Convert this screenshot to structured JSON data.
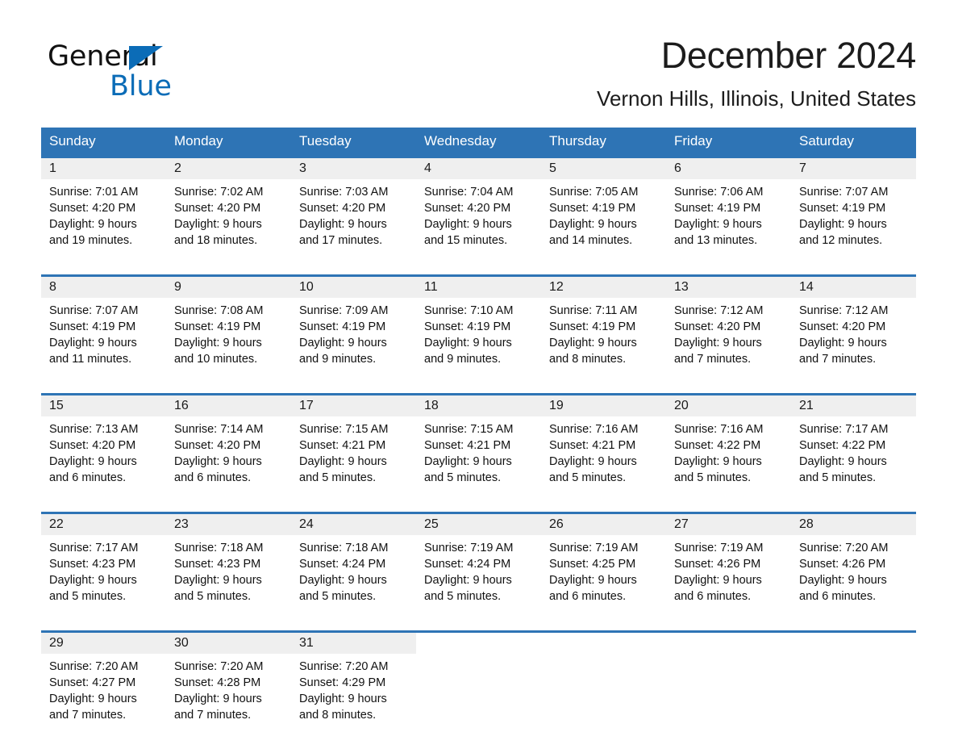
{
  "brand": {
    "name_part1": "General",
    "name_part2": "Blue",
    "triangle_icon": "triangle-icon",
    "accent_color": "#0b6cb7"
  },
  "header": {
    "month_title": "December 2024",
    "location": "Vernon Hills, Illinois, United States"
  },
  "calendar": {
    "header_color": "#2e74b5",
    "daynum_band_color": "#efefef",
    "weekday_headers": [
      "Sunday",
      "Monday",
      "Tuesday",
      "Wednesday",
      "Thursday",
      "Friday",
      "Saturday"
    ],
    "weeks": [
      [
        {
          "day": "1",
          "sunrise": "Sunrise: 7:01 AM",
          "sunset": "Sunset: 4:20 PM",
          "daylight_line1": "Daylight: 9 hours",
          "daylight_line2": "and 19 minutes."
        },
        {
          "day": "2",
          "sunrise": "Sunrise: 7:02 AM",
          "sunset": "Sunset: 4:20 PM",
          "daylight_line1": "Daylight: 9 hours",
          "daylight_line2": "and 18 minutes."
        },
        {
          "day": "3",
          "sunrise": "Sunrise: 7:03 AM",
          "sunset": "Sunset: 4:20 PM",
          "daylight_line1": "Daylight: 9 hours",
          "daylight_line2": "and 17 minutes."
        },
        {
          "day": "4",
          "sunrise": "Sunrise: 7:04 AM",
          "sunset": "Sunset: 4:20 PM",
          "daylight_line1": "Daylight: 9 hours",
          "daylight_line2": "and 15 minutes."
        },
        {
          "day": "5",
          "sunrise": "Sunrise: 7:05 AM",
          "sunset": "Sunset: 4:19 PM",
          "daylight_line1": "Daylight: 9 hours",
          "daylight_line2": "and 14 minutes."
        },
        {
          "day": "6",
          "sunrise": "Sunrise: 7:06 AM",
          "sunset": "Sunset: 4:19 PM",
          "daylight_line1": "Daylight: 9 hours",
          "daylight_line2": "and 13 minutes."
        },
        {
          "day": "7",
          "sunrise": "Sunrise: 7:07 AM",
          "sunset": "Sunset: 4:19 PM",
          "daylight_line1": "Daylight: 9 hours",
          "daylight_line2": "and 12 minutes."
        }
      ],
      [
        {
          "day": "8",
          "sunrise": "Sunrise: 7:07 AM",
          "sunset": "Sunset: 4:19 PM",
          "daylight_line1": "Daylight: 9 hours",
          "daylight_line2": "and 11 minutes."
        },
        {
          "day": "9",
          "sunrise": "Sunrise: 7:08 AM",
          "sunset": "Sunset: 4:19 PM",
          "daylight_line1": "Daylight: 9 hours",
          "daylight_line2": "and 10 minutes."
        },
        {
          "day": "10",
          "sunrise": "Sunrise: 7:09 AM",
          "sunset": "Sunset: 4:19 PM",
          "daylight_line1": "Daylight: 9 hours",
          "daylight_line2": "and 9 minutes."
        },
        {
          "day": "11",
          "sunrise": "Sunrise: 7:10 AM",
          "sunset": "Sunset: 4:19 PM",
          "daylight_line1": "Daylight: 9 hours",
          "daylight_line2": "and 9 minutes."
        },
        {
          "day": "12",
          "sunrise": "Sunrise: 7:11 AM",
          "sunset": "Sunset: 4:19 PM",
          "daylight_line1": "Daylight: 9 hours",
          "daylight_line2": "and 8 minutes."
        },
        {
          "day": "13",
          "sunrise": "Sunrise: 7:12 AM",
          "sunset": "Sunset: 4:20 PM",
          "daylight_line1": "Daylight: 9 hours",
          "daylight_line2": "and 7 minutes."
        },
        {
          "day": "14",
          "sunrise": "Sunrise: 7:12 AM",
          "sunset": "Sunset: 4:20 PM",
          "daylight_line1": "Daylight: 9 hours",
          "daylight_line2": "and 7 minutes."
        }
      ],
      [
        {
          "day": "15",
          "sunrise": "Sunrise: 7:13 AM",
          "sunset": "Sunset: 4:20 PM",
          "daylight_line1": "Daylight: 9 hours",
          "daylight_line2": "and 6 minutes."
        },
        {
          "day": "16",
          "sunrise": "Sunrise: 7:14 AM",
          "sunset": "Sunset: 4:20 PM",
          "daylight_line1": "Daylight: 9 hours",
          "daylight_line2": "and 6 minutes."
        },
        {
          "day": "17",
          "sunrise": "Sunrise: 7:15 AM",
          "sunset": "Sunset: 4:21 PM",
          "daylight_line1": "Daylight: 9 hours",
          "daylight_line2": "and 5 minutes."
        },
        {
          "day": "18",
          "sunrise": "Sunrise: 7:15 AM",
          "sunset": "Sunset: 4:21 PM",
          "daylight_line1": "Daylight: 9 hours",
          "daylight_line2": "and 5 minutes."
        },
        {
          "day": "19",
          "sunrise": "Sunrise: 7:16 AM",
          "sunset": "Sunset: 4:21 PM",
          "daylight_line1": "Daylight: 9 hours",
          "daylight_line2": "and 5 minutes."
        },
        {
          "day": "20",
          "sunrise": "Sunrise: 7:16 AM",
          "sunset": "Sunset: 4:22 PM",
          "daylight_line1": "Daylight: 9 hours",
          "daylight_line2": "and 5 minutes."
        },
        {
          "day": "21",
          "sunrise": "Sunrise: 7:17 AM",
          "sunset": "Sunset: 4:22 PM",
          "daylight_line1": "Daylight: 9 hours",
          "daylight_line2": "and 5 minutes."
        }
      ],
      [
        {
          "day": "22",
          "sunrise": "Sunrise: 7:17 AM",
          "sunset": "Sunset: 4:23 PM",
          "daylight_line1": "Daylight: 9 hours",
          "daylight_line2": "and 5 minutes."
        },
        {
          "day": "23",
          "sunrise": "Sunrise: 7:18 AM",
          "sunset": "Sunset: 4:23 PM",
          "daylight_line1": "Daylight: 9 hours",
          "daylight_line2": "and 5 minutes."
        },
        {
          "day": "24",
          "sunrise": "Sunrise: 7:18 AM",
          "sunset": "Sunset: 4:24 PM",
          "daylight_line1": "Daylight: 9 hours",
          "daylight_line2": "and 5 minutes."
        },
        {
          "day": "25",
          "sunrise": "Sunrise: 7:19 AM",
          "sunset": "Sunset: 4:24 PM",
          "daylight_line1": "Daylight: 9 hours",
          "daylight_line2": "and 5 minutes."
        },
        {
          "day": "26",
          "sunrise": "Sunrise: 7:19 AM",
          "sunset": "Sunset: 4:25 PM",
          "daylight_line1": "Daylight: 9 hours",
          "daylight_line2": "and 6 minutes."
        },
        {
          "day": "27",
          "sunrise": "Sunrise: 7:19 AM",
          "sunset": "Sunset: 4:26 PM",
          "daylight_line1": "Daylight: 9 hours",
          "daylight_line2": "and 6 minutes."
        },
        {
          "day": "28",
          "sunrise": "Sunrise: 7:20 AM",
          "sunset": "Sunset: 4:26 PM",
          "daylight_line1": "Daylight: 9 hours",
          "daylight_line2": "and 6 minutes."
        }
      ],
      [
        {
          "day": "29",
          "sunrise": "Sunrise: 7:20 AM",
          "sunset": "Sunset: 4:27 PM",
          "daylight_line1": "Daylight: 9 hours",
          "daylight_line2": "and 7 minutes."
        },
        {
          "day": "30",
          "sunrise": "Sunrise: 7:20 AM",
          "sunset": "Sunset: 4:28 PM",
          "daylight_line1": "Daylight: 9 hours",
          "daylight_line2": "and 7 minutes."
        },
        {
          "day": "31",
          "sunrise": "Sunrise: 7:20 AM",
          "sunset": "Sunset: 4:29 PM",
          "daylight_line1": "Daylight: 9 hours",
          "daylight_line2": "and 8 minutes."
        },
        {
          "day": "",
          "sunrise": "",
          "sunset": "",
          "daylight_line1": "",
          "daylight_line2": ""
        },
        {
          "day": "",
          "sunrise": "",
          "sunset": "",
          "daylight_line1": "",
          "daylight_line2": ""
        },
        {
          "day": "",
          "sunrise": "",
          "sunset": "",
          "daylight_line1": "",
          "daylight_line2": ""
        },
        {
          "day": "",
          "sunrise": "",
          "sunset": "",
          "daylight_line1": "",
          "daylight_line2": ""
        }
      ]
    ]
  }
}
